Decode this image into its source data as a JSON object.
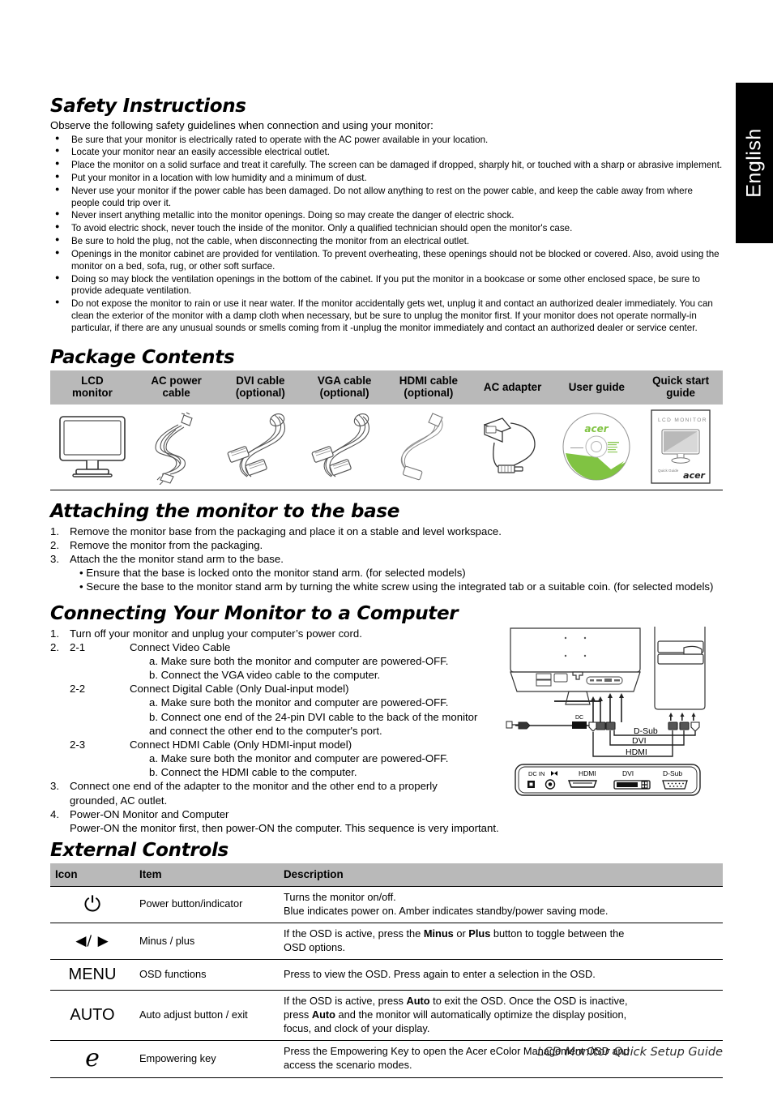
{
  "language_tab": {
    "label": "English"
  },
  "safety": {
    "title": "Safety Instructions",
    "intro": "Observe the following safety guidelines when connection and using your monitor:",
    "bullets": [
      "Be sure that your monitor is electrically rated to operate with the AC power available in your location.",
      "Locate your monitor near an easily accessible electrical outlet.",
      "Place the monitor on a solid surface and treat it carefully. The screen can be damaged if dropped, sharply hit, or touched with a sharp or abrasive implement.",
      "Put your monitor in a location with low humidity and a minimum of dust.",
      "Never use your monitor if the power cable has been damaged. Do not allow anything to rest on the power cable, and keep the cable away from where people could trip over it.",
      "Never insert anything metallic into the monitor openings. Doing so may create the danger of electric shock.",
      "To avoid electric shock, never touch the inside of the monitor. Only a qualified technician should open the monitor's case.",
      "Be sure to hold the plug, not the cable, when disconnecting the monitor from an electrical outlet.",
      "Openings in the monitor cabinet are provided for ventilation. To prevent overheating, these openings should not be blocked or covered. Also, avoid using the monitor on a bed, sofa, rug, or other soft surface.",
      "Doing so may block the ventilation openings in the bottom of the cabinet. If you put the monitor in a bookcase or some other enclosed space, be sure to provide adequate ventilation.",
      "Do not expose the monitor to rain or use it near water. If the monitor accidentally gets wet, unplug it and contact an authorized dealer immediately. You can clean the exterior of the monitor with a damp cloth when necessary, but be sure to unplug the monitor first. If your monitor does not operate normally-in particular, if there are any unusual sounds or smells coming from it -unplug the monitor immediately and contact an authorized dealer or service center."
    ]
  },
  "package": {
    "title": "Package Contents",
    "headers": [
      "LCD\nmonitor",
      "AC power\ncable",
      "DVI cable\n(optional)",
      "VGA cable\n(optional)",
      "HDMI cable\n(optional)",
      "AC adapter",
      "User guide",
      "Quick start\nguide"
    ],
    "items": [
      {
        "name": "LCD monitor",
        "icon": "lcd-monitor-icon"
      },
      {
        "name": "AC power cable",
        "icon": "ac-power-cable-icon"
      },
      {
        "name": "DVI cable",
        "icon": "dvi-cable-icon"
      },
      {
        "name": "VGA cable",
        "icon": "vga-cable-icon"
      },
      {
        "name": "HDMI cable",
        "icon": "hdmi-cable-icon"
      },
      {
        "name": "AC adapter",
        "icon": "ac-adapter-icon"
      },
      {
        "name": "User guide",
        "icon": "user-guide-disc-icon"
      },
      {
        "name": "Quick start guide",
        "icon": "quick-start-guide-booklet-icon"
      }
    ],
    "disc": {
      "brand": "acer"
    },
    "booklet": {
      "heading": "LCD MONITOR",
      "subtext": "Quick Guide",
      "brand": "acer"
    },
    "brand_color": "#80c342"
  },
  "attaching": {
    "title": "Attaching the monitor to the base",
    "steps": [
      {
        "num": "1.",
        "text": "Remove the monitor base from the packaging and place it on a stable and level workspace."
      },
      {
        "num": "2.",
        "text": "Remove the monitor from the packaging."
      },
      {
        "num": "3.",
        "text": "Attach the the monitor stand arm to the base."
      }
    ],
    "sub_bullets": [
      "Ensure that the base is locked onto the monitor stand arm. (for selected models)",
      "Secure the base to the monitor stand arm by turning the white screw using the integrated tab or a suitable coin. (for selected models)"
    ]
  },
  "connecting": {
    "title": "Connecting Your Monitor to a Computer",
    "lines": [
      {
        "num": "1.",
        "sub": "",
        "text": "Turn off your monitor and unplug your computer’s power cord.",
        "level": 1
      },
      {
        "num": "2.",
        "sub": "2-1",
        "text": "Connect Video Cable",
        "level": 2
      },
      {
        "num": "",
        "sub": "",
        "text": "a. Make sure both the monitor and computer are powered-OFF.",
        "level": 3
      },
      {
        "num": "",
        "sub": "",
        "text": "b. Connect the VGA video cable to the computer.",
        "level": 3
      },
      {
        "num": "",
        "sub": "2-2",
        "text": "Connect Digital Cable (Only Dual-input model)",
        "level": 2
      },
      {
        "num": "",
        "sub": "",
        "text": "a. Make sure both the monitor and computer are powered-OFF.",
        "level": 3
      },
      {
        "num": "",
        "sub": "",
        "text": "b. Connect one end of the 24-pin DVI cable to the back of the monitor",
        "level": 3
      },
      {
        "num": "",
        "sub": "",
        "text": "and connect the other end to the computer's port.",
        "level": 3
      },
      {
        "num": "",
        "sub": "2-3",
        "text": "Connect HDMI Cable (Only HDMI-input model)",
        "level": 2
      },
      {
        "num": "",
        "sub": "",
        "text": "a. Make sure both the monitor and computer are powered-OFF.",
        "level": 3
      },
      {
        "num": "",
        "sub": "",
        "text": "b. Connect the HDMI cable to the computer.",
        "level": 3
      },
      {
        "num": "3.",
        "sub": "",
        "text": "Connect one end of the adapter to the monitor and the other end to a properly",
        "level": 1
      },
      {
        "num": "",
        "sub": "",
        "text": "grounded, AC outlet.",
        "level": 1
      },
      {
        "num": "4.",
        "sub": "",
        "text": "Power-ON Monitor and Computer",
        "level": 1
      },
      {
        "num": "",
        "sub": "",
        "text": "Power-ON the monitor first, then power-ON the computer. This sequence is very important.",
        "level": 1
      }
    ],
    "diagram": {
      "labels": {
        "dc": "DC",
        "dsub": "D-Sub",
        "dvi": "DVI",
        "hdmi": "HDMI"
      },
      "port_panel": [
        "DC IN",
        "HDMI",
        "DVI",
        "D-Sub"
      ]
    }
  },
  "external_controls": {
    "title": "External Controls",
    "headers": [
      "Icon",
      "Item",
      "Description"
    ],
    "rows": [
      {
        "icon": "power-button-icon",
        "icon_glyph": "⏻",
        "item": "Power button/indicator",
        "description_lines": [
          "Turns the monitor on/off.",
          "Blue indicates power on. Amber indicates standby/power saving mode."
        ]
      },
      {
        "icon": "minus-plus-arrows-icon",
        "icon_glyph": "◀/ ▶",
        "item": "Minus / plus",
        "description_lines": [
          "If the OSD is active, press the Minus or Plus button to toggle between the",
          "OSD options."
        ],
        "bold_words": [
          "Minus",
          "Plus"
        ]
      },
      {
        "icon": "menu-button-icon",
        "icon_glyph": "MΕNU",
        "item": "OSD functions",
        "description_lines": [
          "Press to view the OSD. Press again to enter a selection in the OSD."
        ]
      },
      {
        "icon": "auto-button-icon",
        "icon_glyph": "AUTO",
        "item": "Auto adjust button / exit",
        "description_lines": [
          "If the OSD is active, press Auto to exit the OSD. Once the OSD is inactive,",
          "press Auto and the monitor will automatically optimize the display position,",
          "focus, and clock of your display."
        ],
        "bold_words": [
          "Auto"
        ]
      },
      {
        "icon": "empowering-key-icon",
        "icon_glyph": "e",
        "item": "Empowering key",
        "description_lines": [
          "Press the Empowering Key to open the Acer eColor Management OSD and",
          "access the scenario modes."
        ]
      }
    ]
  },
  "footer": {
    "text": "LCD Monitor Quick Setup Guide"
  },
  "colors": {
    "table_header_bg": "#b9b9b9",
    "accent_green": "#80c342",
    "tab_bg": "#000000"
  }
}
